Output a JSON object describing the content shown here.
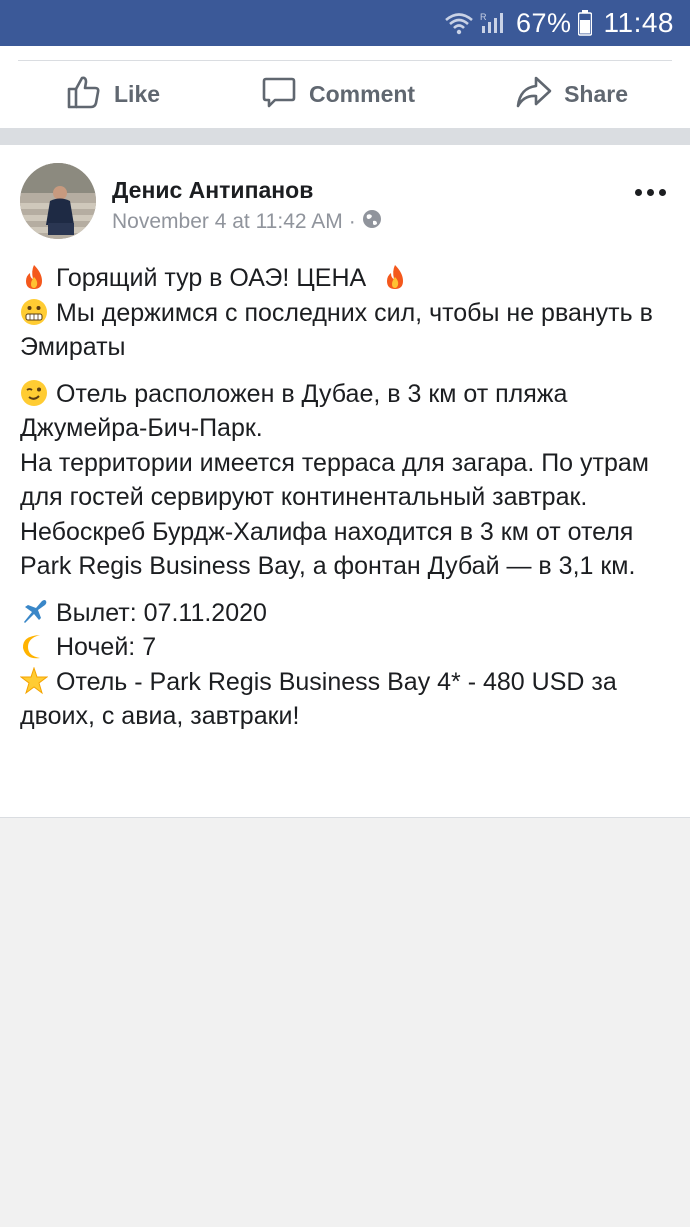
{
  "status_bar": {
    "battery_percent": "67%",
    "time": "11:48",
    "icons": [
      "wifi-icon",
      "signal-icon",
      "battery-icon"
    ]
  },
  "actions": {
    "like_label": "Like",
    "comment_label": "Comment",
    "share_label": "Share"
  },
  "post": {
    "author": "Денис Антипанов",
    "timestamp": "November 4 at 11:42 AM",
    "privacy_icon": "globe-icon",
    "paragraph1": {
      "line1": "Горящий тур в ОАЭ! ЦЕНА",
      "line2": "Мы держимся с последних сил, чтобы не рвануть в Эмираты"
    },
    "paragraph2": {
      "line1": "Отель расположен в Дубае, в 3 км от пляжа Джумейра-Бич-Парк.",
      "line2": "На территории имеется терраса для загара. По утрам для гостей сервируют континентальный завтрак.",
      "line3": "Небоскреб Бурдж-Халифа находится в 3 км от отеля Park Regis Business Bay, а фонтан Дубай — в 3,1 км."
    },
    "paragraph3": {
      "departure": "Вылет: 07.11.2020",
      "nights": "Ночей: 7",
      "hotel": "Отель - Park Regis Business Bay 4* - 480 USD за двоих, с авиа, завтраки!"
    }
  },
  "colors": {
    "status_bar": "#3b5998",
    "action_text": "#606770",
    "meta_text": "#90949c",
    "divider": "#dadde1"
  }
}
